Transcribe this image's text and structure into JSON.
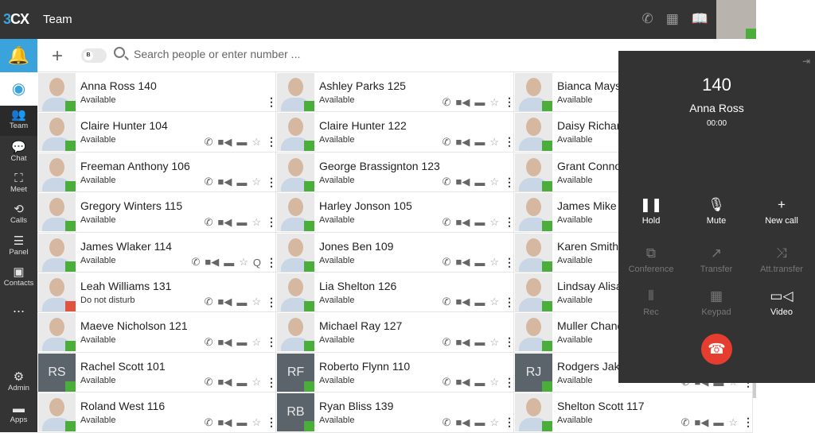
{
  "app": {
    "logo": "3CX",
    "title": "Team"
  },
  "header_icons": [
    "phone-icon",
    "qr-code-icon",
    "book-icon"
  ],
  "sidebar": {
    "items": [
      {
        "label": "Team",
        "icon": "team-icon",
        "active": true
      },
      {
        "label": "Chat",
        "icon": "chat-icon"
      },
      {
        "label": "Meet",
        "icon": "meet-icon"
      },
      {
        "label": "Calls",
        "icon": "history-icon"
      },
      {
        "label": "Panel",
        "icon": "panel-icon"
      },
      {
        "label": "Contacts",
        "icon": "contacts-icon"
      },
      {
        "label": "...",
        "icon": "more-icon"
      },
      {
        "label": "Admin",
        "icon": "gear-icon"
      },
      {
        "label": "Apps",
        "icon": "apps-icon"
      }
    ]
  },
  "toolbar": {
    "search_placeholder": "Search people or enter number ...",
    "toggle_label": "B"
  },
  "contacts": [
    {
      "name": "Anna Ross 140",
      "status": "Available",
      "photo": true,
      "in_call": true
    },
    {
      "name": "Ashley Parks 125",
      "status": "Available",
      "photo": true
    },
    {
      "name": "Bianca Mays",
      "status": "Available",
      "photo": true
    },
    {
      "name": "Claire Hunter 104",
      "status": "Available",
      "photo": true
    },
    {
      "name": "Claire Hunter 122",
      "status": "Available",
      "photo": true
    },
    {
      "name": "Daisy Richar",
      "status": "Available",
      "photo": true
    },
    {
      "name": "Freeman Anthony 106",
      "status": "Available",
      "photo": true
    },
    {
      "name": "George Brassignton 123",
      "status": "Available",
      "photo": true
    },
    {
      "name": "Grant Conno",
      "status": "Available",
      "photo": true
    },
    {
      "name": "Gregory Winters 115",
      "status": "Available",
      "photo": true
    },
    {
      "name": "Harley Jonson 105",
      "status": "Available",
      "photo": true
    },
    {
      "name": "James Mike",
      "status": "Available",
      "photo": true
    },
    {
      "name": "James Wlaker 114",
      "status": "Available",
      "photo": true,
      "extra": "Q"
    },
    {
      "name": "Jones Ben 109",
      "status": "Available",
      "photo": true
    },
    {
      "name": "Karen Smith",
      "status": "Available",
      "photo": true
    },
    {
      "name": "Leah Williams 131",
      "status": "Do not disturb",
      "photo": true,
      "dnd": true
    },
    {
      "name": "Lia Shelton 126",
      "status": "Available",
      "photo": true
    },
    {
      "name": "Lindsay Alisa",
      "status": "Available",
      "photo": true
    },
    {
      "name": "Maeve Nicholson 121",
      "status": "Available",
      "photo": true
    },
    {
      "name": "Michael Ray 127",
      "status": "Available",
      "photo": true
    },
    {
      "name": "Muller Chand",
      "status": "Available",
      "photo": true
    },
    {
      "name": "Rachel Scott 101",
      "status": "Available",
      "initials": "RS"
    },
    {
      "name": "Roberto Flynn 110",
      "status": "Available",
      "initials": "RF"
    },
    {
      "name": "Rodgers Jak",
      "status": "Available",
      "initials": "RJ"
    },
    {
      "name": "Roland West 116",
      "status": "Available",
      "photo": true
    },
    {
      "name": "Ryan Bliss 139",
      "status": "Available",
      "initials": "RB"
    },
    {
      "name": "Shelton Scott 117",
      "status": "Available",
      "photo": true
    }
  ],
  "call": {
    "number": "140",
    "name": "Anna Ross",
    "duration": "00:00",
    "buttons": [
      {
        "label": "Hold",
        "icon": "pause-icon",
        "glyph": "❚❚",
        "enabled": true
      },
      {
        "label": "Mute",
        "icon": "microphone-icon",
        "glyph": "🎙",
        "enabled": true
      },
      {
        "label": "New call",
        "icon": "plus-icon",
        "glyph": "+",
        "enabled": true
      },
      {
        "label": "Conference",
        "icon": "conference-icon",
        "glyph": "⧉",
        "enabled": false
      },
      {
        "label": "Transfer",
        "icon": "transfer-icon",
        "glyph": "↗",
        "enabled": false
      },
      {
        "label": "Att.transfer",
        "icon": "shuffle-icon",
        "glyph": "⤨",
        "enabled": false
      },
      {
        "label": "Rec",
        "icon": "record-icon",
        "glyph": "⦀",
        "enabled": false
      },
      {
        "label": "Keypad",
        "icon": "keypad-icon",
        "glyph": "▦",
        "enabled": false
      },
      {
        "label": "Video",
        "icon": "video-icon",
        "glyph": "▭◁",
        "enabled": true
      }
    ],
    "hangup_glyph": "☎"
  },
  "colors": {
    "accent": "#3ba3dc",
    "available": "#4cae3a",
    "dnd": "#e0533f",
    "hangup": "#e53e30",
    "dark": "#343434"
  }
}
